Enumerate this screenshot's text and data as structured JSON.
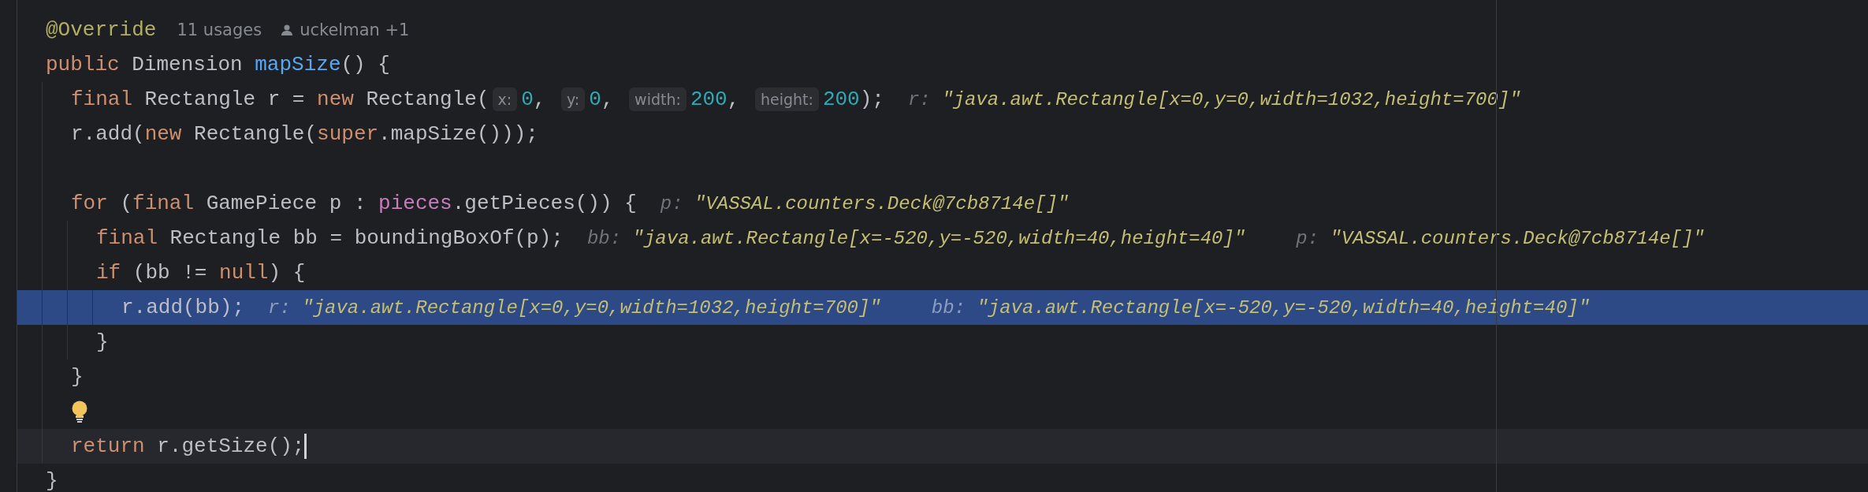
{
  "lines": [
    {
      "kind": "code",
      "selected": false,
      "caret": false,
      "tokens": [
        {
          "kind": "annotation",
          "text": "@Override"
        },
        {
          "kind": "usages",
          "text": "11 usages"
        },
        {
          "kind": "author",
          "text": "uckelman +1"
        }
      ]
    },
    {
      "kind": "code",
      "selected": false,
      "caret": false,
      "tokens": [
        {
          "kind": "keyword",
          "text": "public"
        },
        {
          "kind": "plain",
          "text": " Dimension "
        },
        {
          "kind": "method",
          "text": "mapSize"
        },
        {
          "kind": "plain",
          "text": "() {"
        }
      ],
      "children": [
        {
          "kind": "code",
          "selected": false,
          "caret": false,
          "tokens": [
            {
              "kind": "keyword",
              "text": "final"
            },
            {
              "kind": "plain",
              "text": " Rectangle r = "
            },
            {
              "kind": "keyword",
              "text": "new"
            },
            {
              "kind": "plain",
              "text": " Rectangle("
            },
            {
              "kind": "param",
              "text": "x:"
            },
            {
              "kind": "number",
              "text": "0"
            },
            {
              "kind": "plain",
              "text": ", "
            },
            {
              "kind": "param",
              "text": "y:"
            },
            {
              "kind": "number",
              "text": "0"
            },
            {
              "kind": "plain",
              "text": ", "
            },
            {
              "kind": "param",
              "text": "width:"
            },
            {
              "kind": "number",
              "text": "200"
            },
            {
              "kind": "plain",
              "text": ", "
            },
            {
              "kind": "param",
              "text": "height:"
            },
            {
              "kind": "number",
              "text": "200"
            },
            {
              "kind": "plain",
              "text": ");"
            },
            {
              "kind": "debug",
              "name": "r:",
              "text": "\"java.awt.Rectangle[x=0,y=0,width=1032,height=700]\""
            }
          ]
        },
        {
          "kind": "code",
          "selected": false,
          "caret": false,
          "tokens": [
            {
              "kind": "plain",
              "text": "r.add("
            },
            {
              "kind": "keyword",
              "text": "new"
            },
            {
              "kind": "plain",
              "text": " Rectangle("
            },
            {
              "kind": "keyword",
              "text": "super"
            },
            {
              "kind": "plain",
              "text": ".mapSize()));"
            }
          ]
        },
        {
          "kind": "blank",
          "selected": false,
          "caret": false
        },
        {
          "kind": "code",
          "selected": false,
          "caret": false,
          "tokens": [
            {
              "kind": "keyword",
              "text": "for"
            },
            {
              "kind": "plain",
              "text": " ("
            },
            {
              "kind": "keyword",
              "text": "final"
            },
            {
              "kind": "plain",
              "text": " GamePiece p : "
            },
            {
              "kind": "field",
              "text": "pieces"
            },
            {
              "kind": "plain",
              "text": ".getPieces()) {"
            },
            {
              "kind": "debug",
              "name": "p:",
              "text": "\"VASSAL.counters.Deck@7cb8714e[]\""
            }
          ],
          "children": [
            {
              "kind": "code",
              "selected": false,
              "caret": false,
              "tokens": [
                {
                  "kind": "keyword",
                  "text": "final"
                },
                {
                  "kind": "plain",
                  "text": " Rectangle bb = boundingBoxOf(p);"
                },
                {
                  "kind": "debug",
                  "name": "bb:",
                  "text": "\"java.awt.Rectangle[x=-520,y=-520,width=40,height=40]\""
                },
                {
                  "kind": "debug",
                  "name": "p:",
                  "text": "\"VASSAL.counters.Deck@7cb8714e[]\""
                }
              ]
            },
            {
              "kind": "code",
              "selected": false,
              "caret": false,
              "tokens": [
                {
                  "kind": "keyword",
                  "text": "if"
                },
                {
                  "kind": "plain",
                  "text": " (bb != "
                },
                {
                  "kind": "keyword",
                  "text": "null"
                },
                {
                  "kind": "plain",
                  "text": ") {"
                }
              ],
              "children": [
                {
                  "kind": "code",
                  "selected": true,
                  "caret": false,
                  "tokens": [
                    {
                      "kind": "plain",
                      "text": "r.add(bb);"
                    },
                    {
                      "kind": "debug",
                      "name": "r:",
                      "text": "\"java.awt.Rectangle[x=0,y=0,width=1032,height=700]\""
                    },
                    {
                      "kind": "debug",
                      "name": "bb:",
                      "text": "\"java.awt.Rectangle[x=-520,y=-520,width=40,height=40]\""
                    }
                  ]
                }
              ]
            },
            {
              "kind": "code",
              "selected": false,
              "caret": false,
              "tokens": [
                {
                  "kind": "plain",
                  "text": "}"
                }
              ]
            }
          ]
        },
        {
          "kind": "code",
          "selected": false,
          "caret": false,
          "tokens": [
            {
              "kind": "plain",
              "text": "}"
            }
          ]
        },
        {
          "kind": "bulb",
          "selected": false,
          "caret": false
        },
        {
          "kind": "code",
          "selected": false,
          "caret": true,
          "tokens": [
            {
              "kind": "keyword",
              "text": "return"
            },
            {
              "kind": "plain",
              "text": " r.getSize();"
            }
          ]
        }
      ]
    },
    {
      "kind": "code",
      "selected": false,
      "caret": false,
      "tokens": [
        {
          "kind": "plain",
          "text": "}"
        }
      ]
    }
  ]
}
